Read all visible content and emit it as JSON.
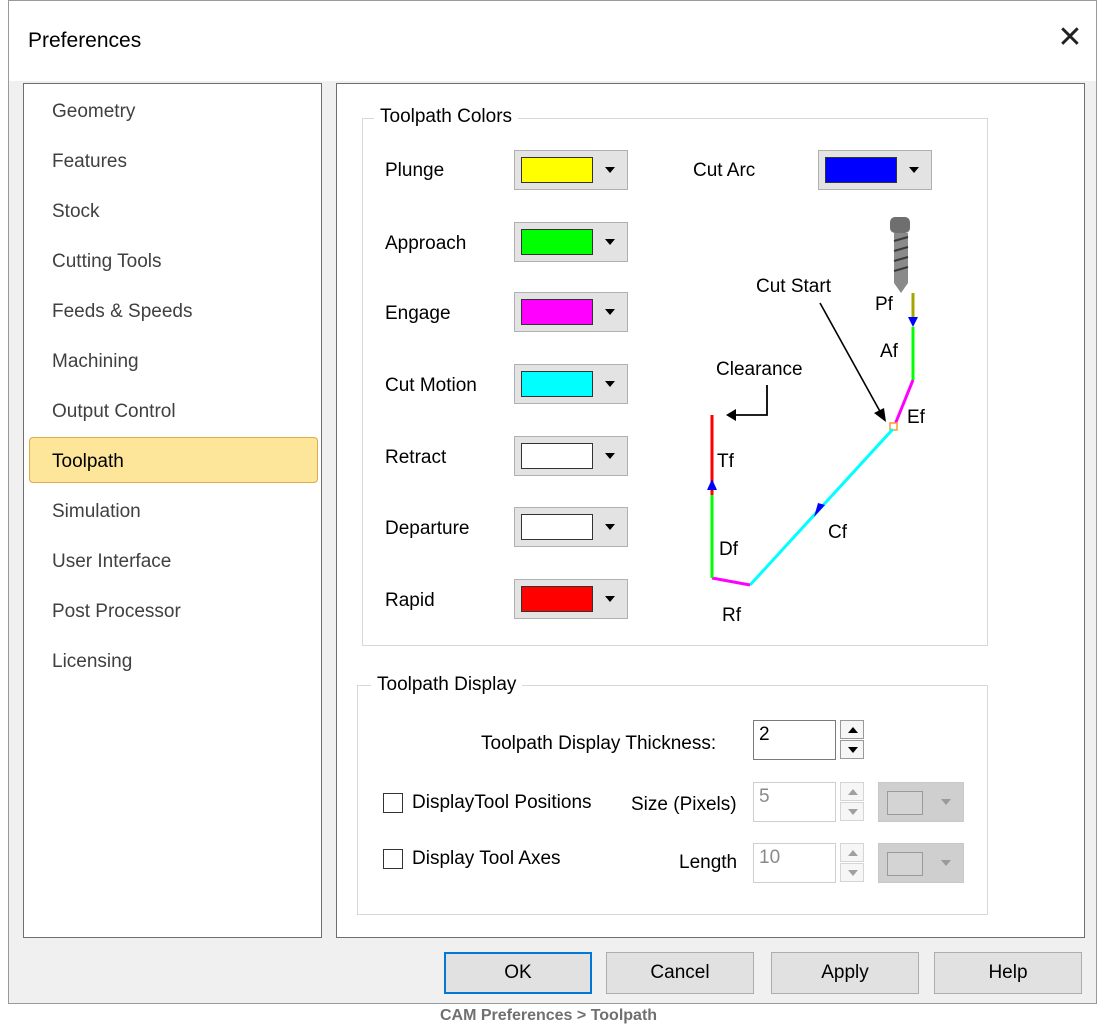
{
  "window": {
    "title": "Preferences"
  },
  "nav": {
    "items": [
      "Geometry",
      "Features",
      "Stock",
      "Cutting Tools",
      "Feeds & Speeds",
      "Machining",
      "Output Control",
      "Toolpath",
      "Simulation",
      "User Interface",
      "Post Processor",
      "Licensing"
    ],
    "selected": "Toolpath"
  },
  "toolpath_colors": {
    "title": "Toolpath Colors",
    "rows": [
      {
        "label": "Plunge",
        "color": "#ffff00"
      },
      {
        "label": "Approach",
        "color": "#00ff00"
      },
      {
        "label": "Engage",
        "color": "#ff00ff"
      },
      {
        "label": "Cut Motion",
        "color": "#00ffff"
      },
      {
        "label": "Retract",
        "color": "#ffffff"
      },
      {
        "label": "Departure",
        "color": "#ffffff"
      },
      {
        "label": "Rapid",
        "color": "#ff0000"
      }
    ],
    "cut_arc": {
      "label": "Cut Arc",
      "color": "#0000ff"
    }
  },
  "diagram": {
    "labels": {
      "cut_start": "Cut Start",
      "clearance": "Clearance",
      "pf": "Pf",
      "af": "Af",
      "ef": "Ef",
      "tf": "Tf",
      "cf": "Cf",
      "df": "Df",
      "rf": "Rf"
    }
  },
  "toolpath_display": {
    "title": "Toolpath Display",
    "thickness_label": "Toolpath Display Thickness:",
    "thickness_value": "2",
    "tool_positions": {
      "label": "DisplayTool Positions",
      "checked": false,
      "size_label": "Size (Pixels)",
      "size_value": "5"
    },
    "tool_axes": {
      "label": "Display Tool Axes",
      "checked": false,
      "length_label": "Length",
      "length_value": "10"
    }
  },
  "buttons": {
    "ok": "OK",
    "cancel": "Cancel",
    "apply": "Apply",
    "help": "Help"
  },
  "caption": "CAM Preferences > Toolpath",
  "icons": {
    "close": "close-icon",
    "dropdown": "chevron-down-icon",
    "tool": "drill-tool-icon"
  }
}
